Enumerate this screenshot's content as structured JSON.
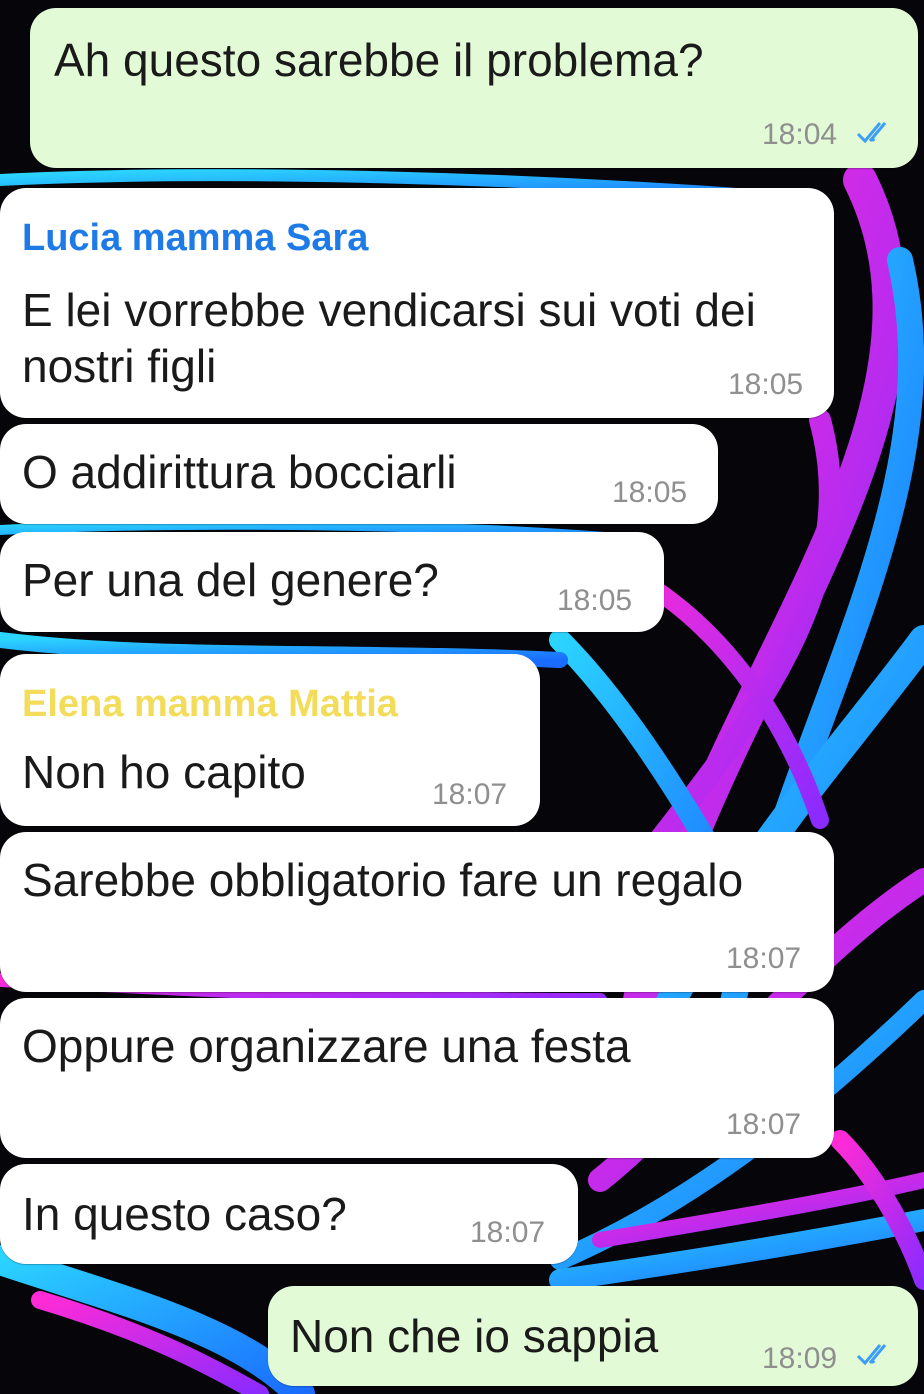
{
  "theme": {
    "incoming_bubble": "#ffffff",
    "outgoing_bubble": "#e2fbd6",
    "read_ticks": "#3d9ef5",
    "sender_colors": {
      "lucia": "#1e7ae6",
      "elena": "#f2dc5a"
    },
    "wallpaper": "black background with neon blue and magenta swirl"
  },
  "messages": [
    {
      "direction": "outgoing",
      "text": "Ah questo sarebbe il problema?",
      "time": "18:04",
      "status": "read",
      "status_icon": "double-check-icon"
    },
    {
      "direction": "incoming",
      "sender": "Lucia mamma Sara",
      "text": "E lei vorrebbe vendicarsi sui voti dei nostri figli",
      "time": "18:05"
    },
    {
      "direction": "incoming",
      "text": "O addirittura bocciarli",
      "time": "18:05"
    },
    {
      "direction": "incoming",
      "text": "Per una del genere?",
      "time": "18:05"
    },
    {
      "direction": "incoming",
      "sender": "Elena mamma Mattia",
      "text": "Non ho capito",
      "time": "18:07"
    },
    {
      "direction": "incoming",
      "text": "Sarebbe obbligatorio fare un regalo",
      "time": "18:07"
    },
    {
      "direction": "incoming",
      "text": "Oppure organizzare una festa",
      "time": "18:07"
    },
    {
      "direction": "incoming",
      "text": "In questo caso?",
      "time": "18:07"
    },
    {
      "direction": "outgoing",
      "text": "Non che io sappia",
      "time": "18:09",
      "status": "read",
      "status_icon": "double-check-icon"
    }
  ]
}
